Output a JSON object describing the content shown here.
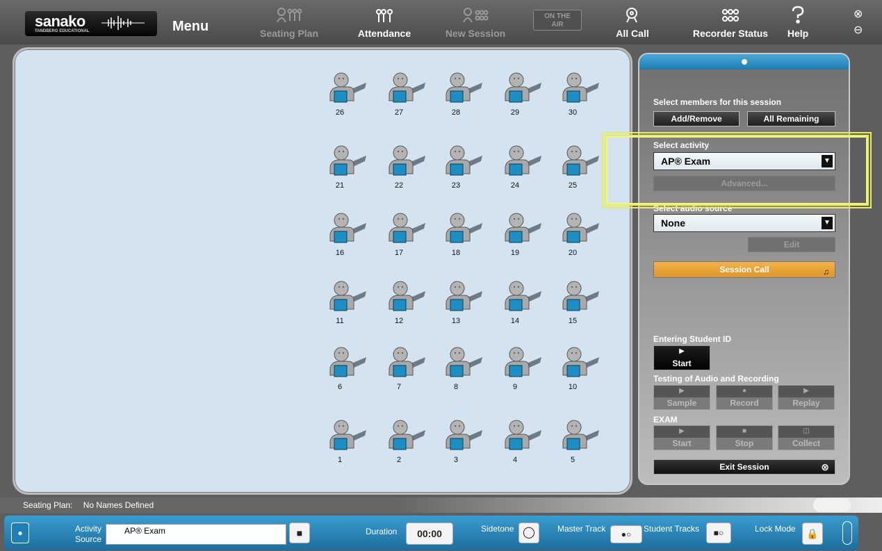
{
  "toolbar": {
    "brand": "sanako",
    "brand_sub": "TANDBERG EDUCATIONAL",
    "menu": "Menu",
    "seating_plan": "Seating Plan",
    "attendance": "Attendance",
    "new_session": "New Session",
    "on_the_air_line1": "ON THE",
    "on_the_air_line2": "AIR",
    "all_call": "All Call",
    "recorder_status": "Recorder Status",
    "help": "Help"
  },
  "seats": {
    "row1": [
      "26",
      "27",
      "28",
      "29",
      "30"
    ],
    "row2": [
      "21",
      "22",
      "23",
      "24",
      "25"
    ],
    "row3": [
      "16",
      "17",
      "18",
      "19",
      "20"
    ],
    "row4": [
      "11",
      "12",
      "13",
      "14",
      "15"
    ],
    "row5": [
      "6",
      "7",
      "8",
      "9",
      "10"
    ],
    "row6": [
      "1",
      "2",
      "3",
      "4",
      "5"
    ]
  },
  "panel": {
    "select_members": "Select members for this session",
    "add_remove": "Add/Remove",
    "all_remaining": "All Remaining",
    "select_activity": "Select activity",
    "activity_value": "AP® Exam",
    "advanced": "Advanced...",
    "select_audio": "Select audio source",
    "audio_value": "None",
    "edit": "Edit",
    "session_call": "Session Call",
    "entering_student_id": "Entering Student ID",
    "start": "Start",
    "testing_label": "Testing of Audio and Recording",
    "sample": "Sample",
    "record": "Record",
    "replay": "Replay",
    "exam": "EXAM",
    "exam_start": "Start",
    "exam_stop": "Stop",
    "exam_collect": "Collect",
    "exit_session": "Exit Session"
  },
  "status": {
    "label": "Seating Plan:",
    "value": "No Names Defined"
  },
  "bottom": {
    "activity_label": "Activity",
    "source_label": "Source",
    "activity_value": "AP® Exam",
    "duration_label": "Duration",
    "duration_value": "00:00",
    "sidetone": "Sidetone",
    "master_track": "Master Track",
    "student_tracks": "Student Tracks",
    "lock_mode": "Lock Mode"
  }
}
